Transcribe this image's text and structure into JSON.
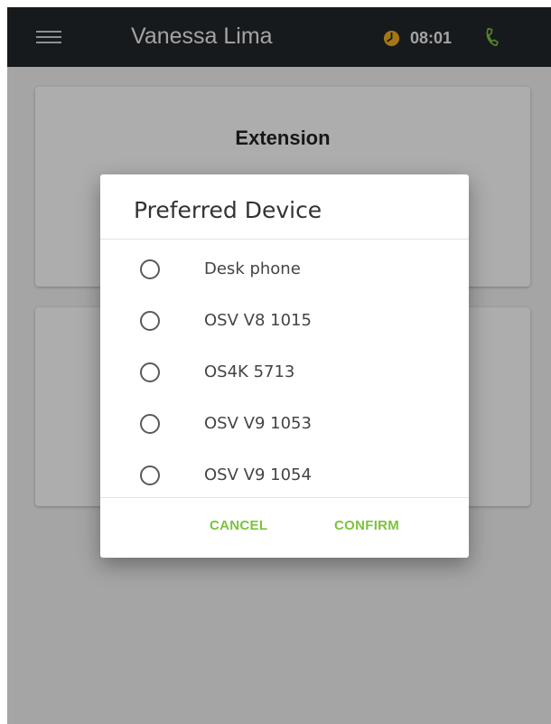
{
  "header": {
    "user_name": "Vanessa Lima",
    "time": "08:01",
    "icons": {
      "menu": "hamburger-menu-icon",
      "status": "clock-status-icon",
      "phone": "phone-icon"
    },
    "colors": {
      "background": "#23272a",
      "status": "#f0b21e",
      "phone": "#7cc43c"
    }
  },
  "main": {
    "extension_card": {
      "title": "Extension"
    }
  },
  "dialog": {
    "title": "Preferred Device",
    "options": [
      {
        "label": "Desk phone",
        "selected": false
      },
      {
        "label": "OSV V8 1015",
        "selected": false
      },
      {
        "label": "OS4K 5713",
        "selected": false
      },
      {
        "label": "OSV V9 1053",
        "selected": false
      },
      {
        "label": "OSV V9 1054",
        "selected": false
      }
    ],
    "cancel_label": "CANCEL",
    "confirm_label": "CONFIRM",
    "accent_color": "#7cc43c"
  }
}
